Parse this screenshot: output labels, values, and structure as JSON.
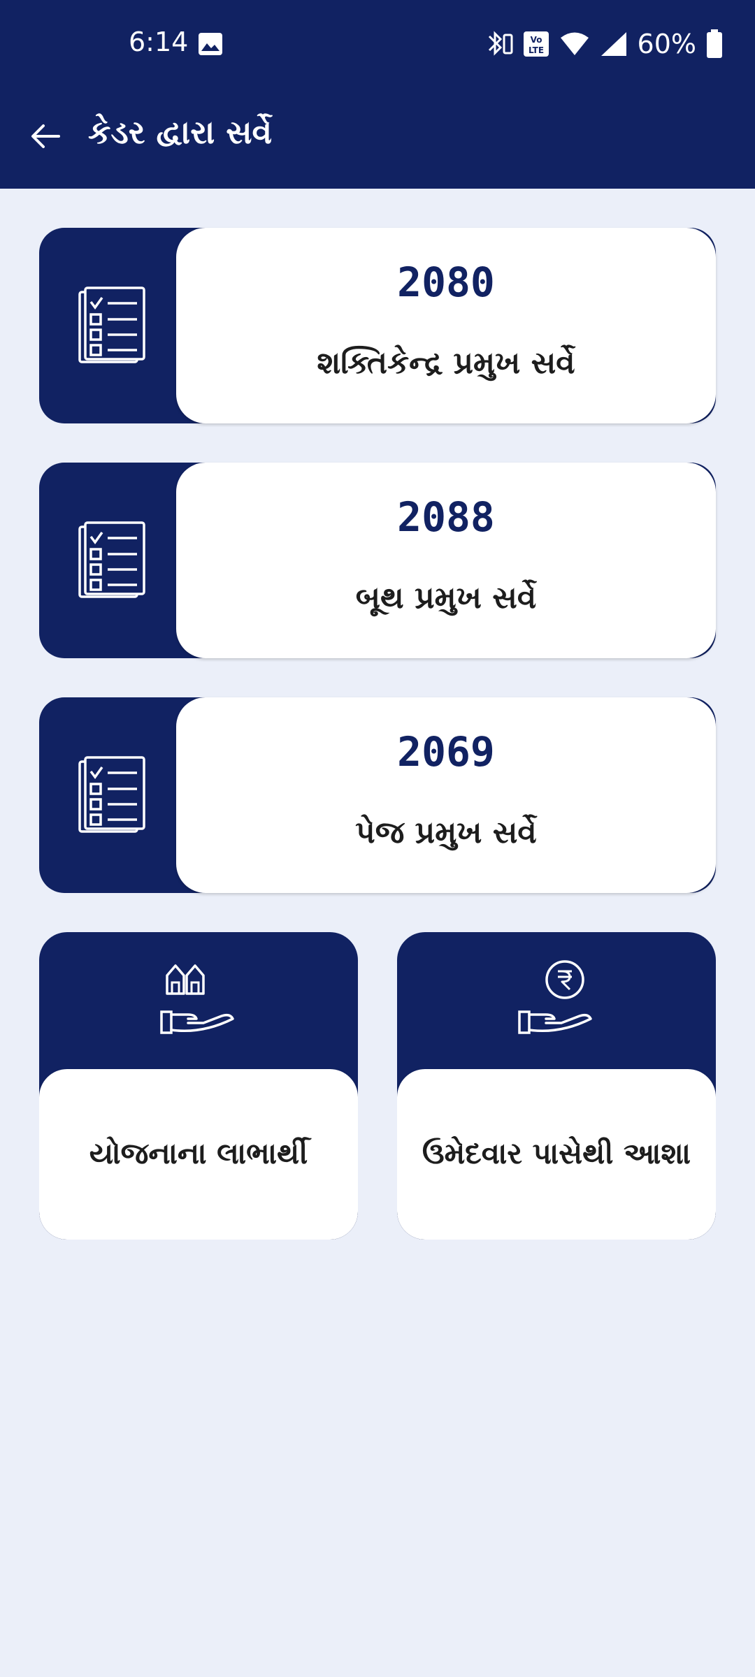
{
  "status_bar": {
    "time": "6:14",
    "battery": "60%",
    "icons": [
      "gallery-icon",
      "bluetooth-icon",
      "volte-icon",
      "wifi-icon",
      "signal-icon",
      "battery-icon"
    ]
  },
  "header": {
    "title": "કેડર દ્વારા સર્વે",
    "back_icon": "arrow-left-icon"
  },
  "surveys": [
    {
      "count": "2080",
      "label": "શક્તિકેન્દ્ર પ્રમુખ સર્વે",
      "icon": "checklist-icon"
    },
    {
      "count": "2088",
      "label": "બૂથ પ્રમુખ સર્વે",
      "icon": "checklist-icon"
    },
    {
      "count": "2069",
      "label": "પેજ પ્રમુખ સર્વે",
      "icon": "checklist-icon"
    }
  ],
  "tiles": [
    {
      "label": "યોજનાના લાભાર્થી",
      "icon": "hand-houses-icon"
    },
    {
      "label": "ઉમેદવાર પાસેથી આશા",
      "icon": "hand-rupee-icon"
    }
  ],
  "colors": {
    "primary": "#112262",
    "background": "#ebeff9",
    "card": "#ffffff",
    "text": "#1d1d1d"
  }
}
